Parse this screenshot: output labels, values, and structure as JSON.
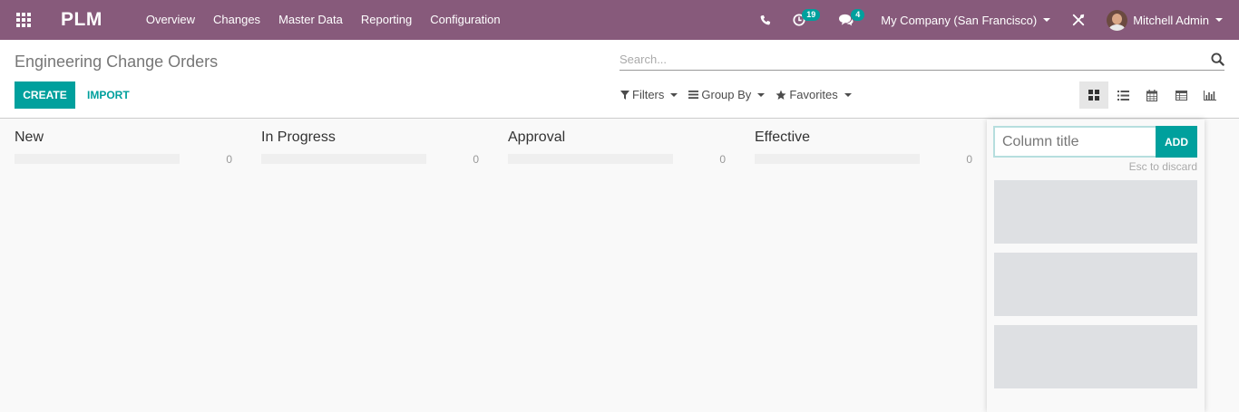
{
  "navbar": {
    "brand": "PLM",
    "menu": [
      "Overview",
      "Changes",
      "Master Data",
      "Reporting",
      "Configuration"
    ],
    "activity_count": "19",
    "message_count": "4",
    "company": "My Company (San Francisco)",
    "user": "Mitchell Admin",
    "color": "#875a7b"
  },
  "control_panel": {
    "title": "Engineering Change Orders",
    "search_placeholder": "Search...",
    "create_label": "CREATE",
    "import_label": "IMPORT",
    "filters_label": "Filters",
    "group_by_label": "Group By",
    "favorites_label": "Favorites",
    "views": [
      "kanban-icon",
      "list-icon",
      "calendar-icon",
      "pivot-icon",
      "graph-icon"
    ],
    "active_view": "kanban"
  },
  "kanban": {
    "columns": [
      {
        "title": "New",
        "count": "0"
      },
      {
        "title": "In Progress",
        "count": "0"
      },
      {
        "title": "Approval",
        "count": "0"
      },
      {
        "title": "Effective",
        "count": "0"
      }
    ],
    "quick_create": {
      "placeholder": "Column title",
      "add_label": "ADD",
      "hint": "Esc to discard"
    }
  },
  "colors": {
    "accent": "#00a09d",
    "brand": "#875a7b"
  }
}
